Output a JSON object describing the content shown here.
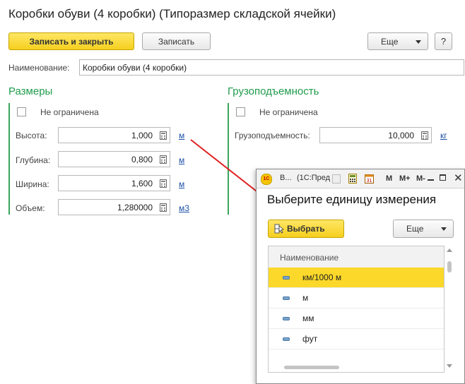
{
  "window": {
    "title": "Коробки обуви (4 коробки) (Типоразмер складской ячейки)"
  },
  "toolbar": {
    "save_close": "Записать и закрыть",
    "save": "Записать",
    "more": "Еще",
    "help": "?"
  },
  "name_field": {
    "label": "Наименование:",
    "value": "Коробки обуви (4 коробки)"
  },
  "sizes": {
    "title": "Размеры",
    "unlimited_label": "Не ограничена",
    "height": {
      "label": "Высота:",
      "value": "1,000",
      "unit": "м"
    },
    "depth": {
      "label": "Глубина:",
      "value": "0,800",
      "unit": "м"
    },
    "width": {
      "label": "Ширина:",
      "value": "1,600",
      "unit": "м"
    },
    "volume": {
      "label": "Объем:",
      "value": "1,280000",
      "unit": "м3"
    }
  },
  "capacity": {
    "title": "Грузоподъемность",
    "unlimited_label": "Не ограничена",
    "field": {
      "label": "Грузоподъемность:",
      "value": "10,000",
      "unit": "кг"
    }
  },
  "popup": {
    "tab_short": "В...",
    "tab_context": "(1С:Пред",
    "m_label": "M",
    "mplus_label": "M+",
    "mminus_label": "M-",
    "heading": "Выберите единицу измерения",
    "choose_button": "Выбрать",
    "more_button": "Еще",
    "column_header": "Наименование",
    "rows": [
      "км/1000 м",
      "м",
      "мм",
      "фут"
    ]
  },
  "colors": {
    "accent_green": "#1f9b4b",
    "selection_yellow": "#fbd829",
    "link_blue": "#1b4fa8",
    "arrow_red": "#e02020"
  }
}
